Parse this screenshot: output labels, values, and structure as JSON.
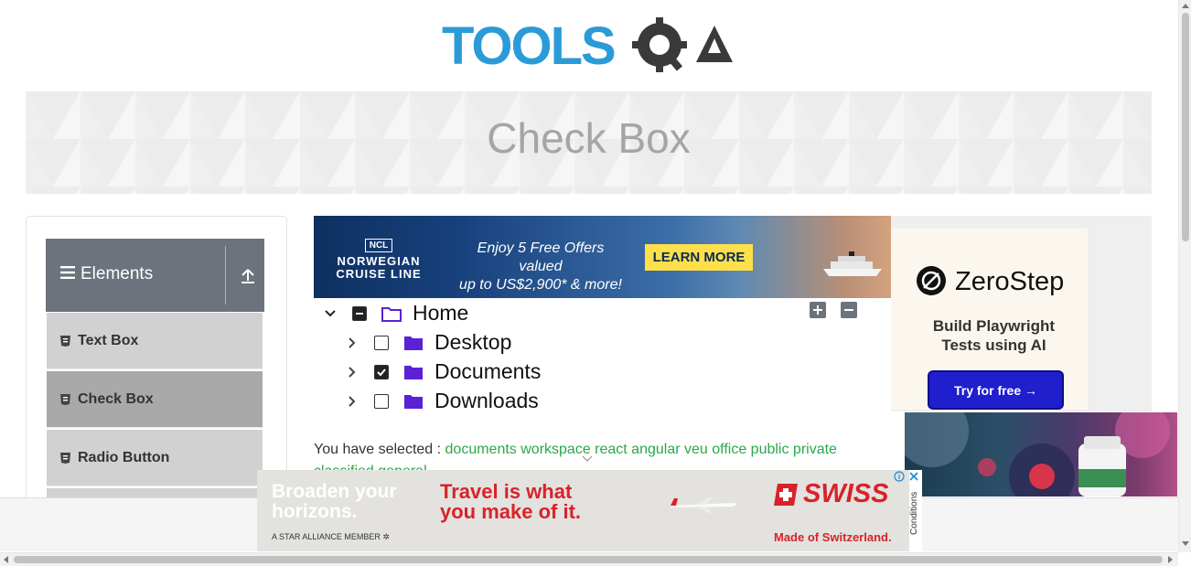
{
  "site": {
    "logo_text": "TOOLSQA",
    "page_title": "Check Box"
  },
  "sidebar": {
    "group_title": "Elements",
    "items": [
      {
        "label": "Text Box",
        "active": false
      },
      {
        "label": "Check Box",
        "active": true
      },
      {
        "label": "Radio Button",
        "active": false
      }
    ]
  },
  "ads": {
    "ncl": {
      "logo_box": "NCL",
      "name_line1": "NORWEGIAN",
      "name_line2": "CRUISE LINE",
      "offer_line1": "Enjoy 5 Free Offers valued",
      "offer_line2": "up to US$2,900* & more!",
      "cta": "LEARN MORE"
    },
    "zerostep": {
      "name": "ZeroStep",
      "tagline_line1": "Build Playwright",
      "tagline_line2": "Tests using AI",
      "cta": "Try for free →"
    },
    "swiss": {
      "left_line1": "Broaden your",
      "left_line2": "horizons.",
      "alliance": "A STAR ALLIANCE MEMBER",
      "slogan_line1": "Travel is what",
      "slogan_line2": "you make of it.",
      "brand": "SWISS",
      "made": "Made of Switzerland.",
      "conditions": "Conditions"
    }
  },
  "tree": {
    "root": {
      "label": "Home",
      "expanded": true,
      "state": "partial"
    },
    "children": [
      {
        "label": "Desktop",
        "expanded": false,
        "state": "unchecked"
      },
      {
        "label": "Documents",
        "expanded": false,
        "state": "checked"
      },
      {
        "label": "Downloads",
        "expanded": false,
        "state": "unchecked"
      }
    ]
  },
  "result": {
    "prefix": "You have selected :",
    "selected": [
      "documents",
      "workspace",
      "react",
      "angular",
      "veu",
      "office",
      "public",
      "private",
      "classified",
      "general"
    ]
  },
  "colors": {
    "accent_blue": "#1f9be0",
    "selected_green": "#2ba84a",
    "folder_purple": "#5b21d6",
    "sidebar_header": "#6c737c"
  }
}
